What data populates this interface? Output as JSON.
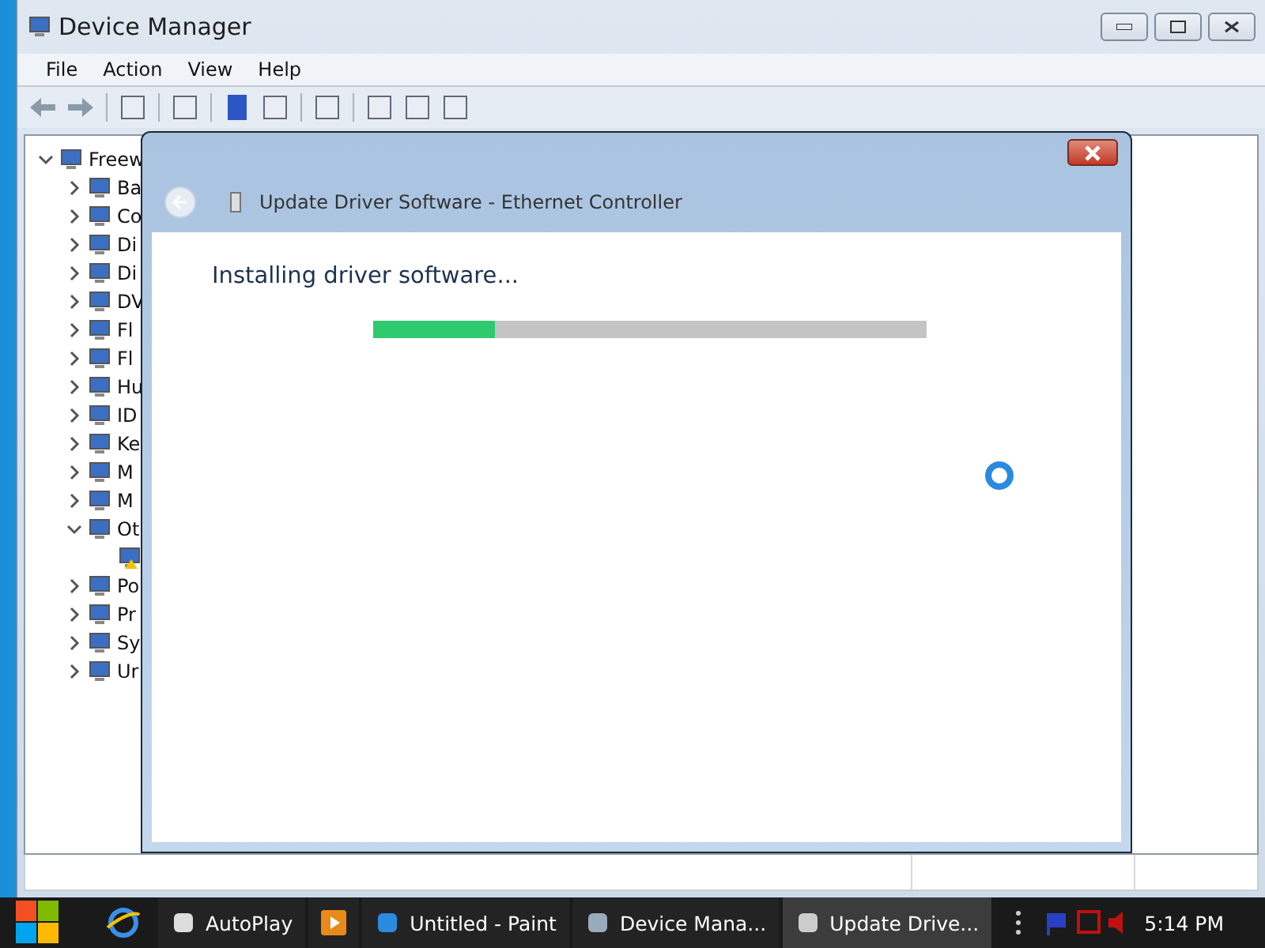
{
  "window": {
    "title": "Device Manager"
  },
  "menu": [
    "File",
    "Action",
    "View",
    "Help"
  ],
  "tree": {
    "label": "Freew",
    "expanded": true,
    "children": [
      {
        "label": "Ba",
        "expanded": false
      },
      {
        "label": "Co",
        "expanded": false
      },
      {
        "label": "Di",
        "expanded": false
      },
      {
        "label": "Di",
        "expanded": false
      },
      {
        "label": "DV",
        "expanded": false
      },
      {
        "label": "Fl",
        "expanded": false
      },
      {
        "label": "Fl",
        "expanded": false
      },
      {
        "label": "Hu",
        "expanded": false
      },
      {
        "label": "ID",
        "expanded": false
      },
      {
        "label": "Ke",
        "expanded": false
      },
      {
        "label": "M",
        "expanded": false
      },
      {
        "label": "M",
        "expanded": false
      },
      {
        "label": "Ot",
        "expanded": true,
        "children": [
          {
            "warning": true
          }
        ]
      },
      {
        "label": "Po",
        "expanded": false
      },
      {
        "label": "Pr",
        "expanded": false
      },
      {
        "label": "Sy",
        "expanded": false
      },
      {
        "label": "Ur",
        "expanded": false
      }
    ]
  },
  "dialog": {
    "title": "Update Driver Software - Ethernet Controller",
    "back_disabled": true,
    "heading": "Installing driver software...",
    "progress": {
      "level": 0.22
    }
  },
  "taskbar": {
    "items": [
      {
        "label": "AutoPlay",
        "selected": false
      },
      {
        "label": "Untitled - Paint",
        "selected": false
      },
      {
        "label": "Device Mana...",
        "selected": false
      },
      {
        "label": "Update Drive...",
        "selected": true
      }
    ],
    "clock": "5:14 PM"
  }
}
